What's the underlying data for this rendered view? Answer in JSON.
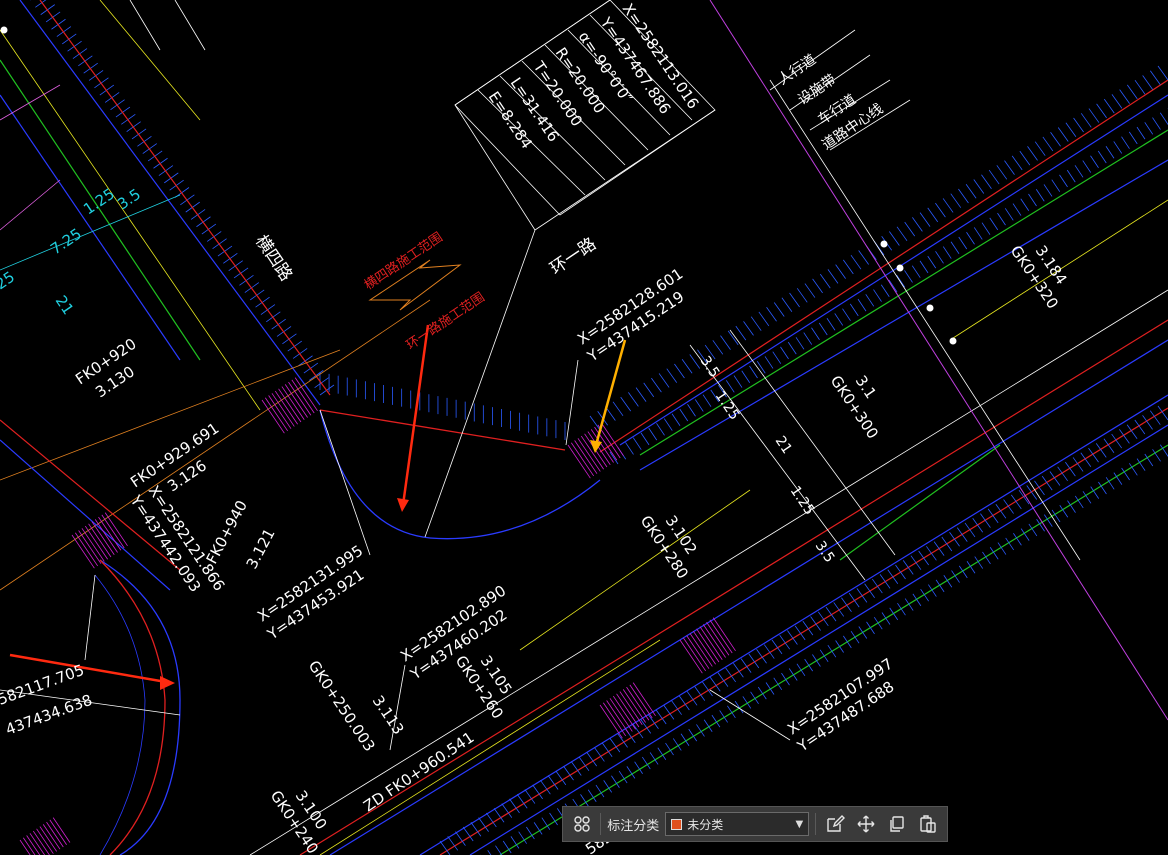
{
  "labels": {
    "curve_x": "X=2582113.016",
    "curve_y": "Y=437467.886",
    "curve_alpha": "α=-90°0′0″",
    "curve_r": "R=20.000",
    "curve_t": "T=20.000",
    "curve_l": "L=31.416",
    "curve_e": "E=8.284",
    "road_left": "横四路",
    "road_right": "环一路",
    "scope_1": "横四路施工范围",
    "scope_2": "环一路施工范围",
    "legend_1": "人行道",
    "legend_2": "设施带",
    "legend_3": "车行道",
    "legend_4": "道路中心线",
    "pt_a_x": "X=2582128.601",
    "pt_a_y": "Y=437415.219",
    "fk920": "FK0+920",
    "fk920_v": "3.130",
    "fk929": "FK0+929.691",
    "fk929_v": "3.126",
    "pt_b_x": "X=2582121.866",
    "pt_b_y": "Y=437442.093",
    "fk940": "FK0+940",
    "fk940_v": "3.121",
    "pt_c_x": "X=2582131.995",
    "pt_c_y": "Y=437453.921",
    "pt_d_x": "X=2582102.890",
    "pt_d_y": "Y=437460.202",
    "gk280": "GK0+280",
    "gk280_v": "3.102",
    "gk260": "GK0+260",
    "gk260_v": "3.105",
    "gk250": "GK0+250.003",
    "gk250_v": "3.113",
    "zd": "ZD FK0+960.541",
    "pt_e_x": "X=2582107.997",
    "pt_e_y": "Y=437487.688",
    "pt_f_x": "582117.705",
    "pt_f_y": "437434.638",
    "gk240": "GK0+240",
    "gk240_v": "3.100",
    "gk300": "GK0+300",
    "gk300_v": "3.1",
    "gk320": "GK0+320",
    "gk320_v": "3.184",
    "dim_35": "3.5",
    "dim_125": "1.25",
    "dim_725": "7.25",
    "dim_21": "21",
    "dim_25": "25",
    "dim_s35": "3.5",
    "dim_s125": "1.25",
    "dim_s21": "21",
    "dim_s125b": "1.25",
    "dim_s35b": "3.5",
    "bottom_frag": "582"
  },
  "toolbar": {
    "label": "标注分类",
    "select_value": "未分类",
    "swatch_color": "#e0501e"
  },
  "icons": {
    "grid": "grid-icon",
    "edit": "edit-icon",
    "move": "move-icon",
    "copy": "copy-icon",
    "paste": "paste-icon"
  }
}
